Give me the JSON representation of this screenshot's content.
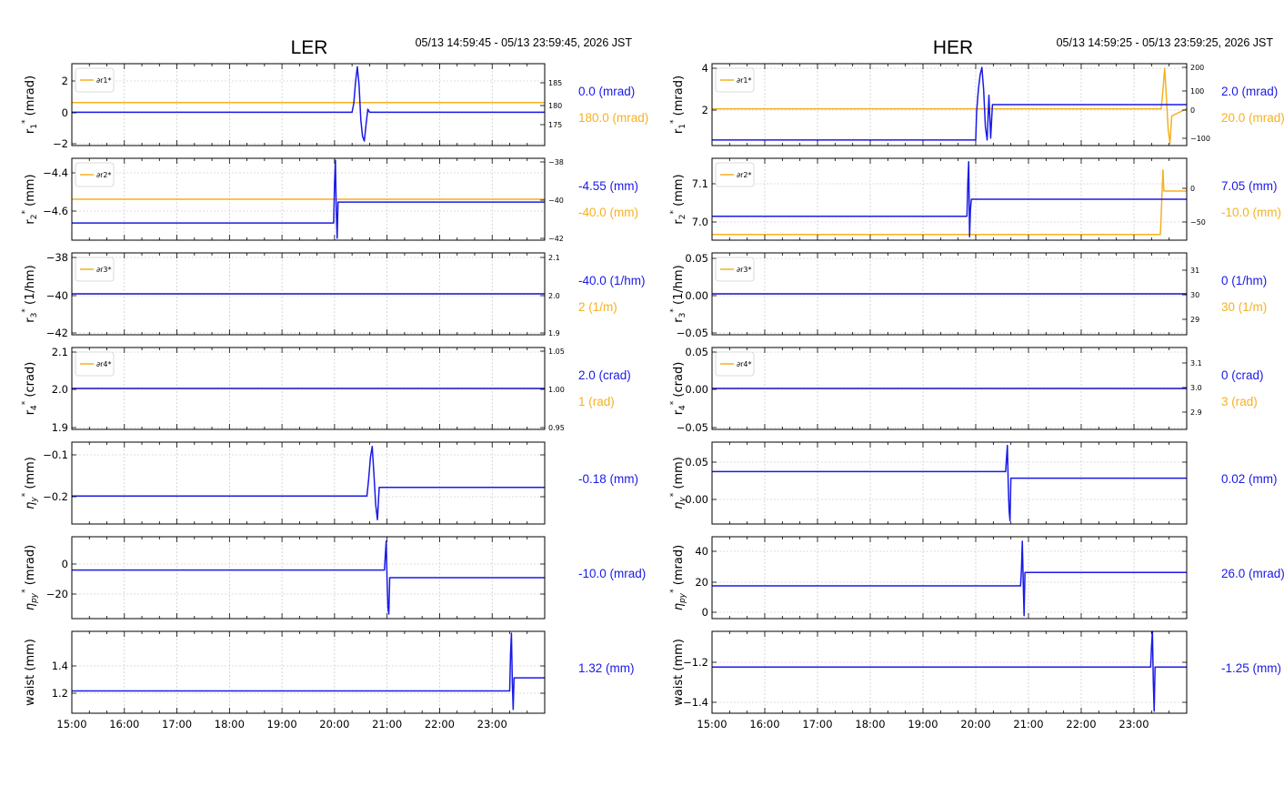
{
  "colors": {
    "blue": "#1a1ae6",
    "orange": "#f5b120",
    "frame": "#000000",
    "grid": "#bdbdbd"
  },
  "panels": [
    {
      "title": "LER",
      "time_range": "05/13 14:59:45 - 05/13 23:59:45, 2026 JST",
      "x_ticks": [
        "15:00",
        "16:00",
        "17:00",
        "18:00",
        "19:00",
        "20:00",
        "21:00",
        "22:00",
        "23:00"
      ],
      "rows": [
        {
          "ylabel": "r1* (mrad)",
          "legend": "∂r1*",
          "left_ticks": [
            "2",
            "0",
            "−2"
          ],
          "right_ticks": [
            "185",
            "180",
            "175"
          ],
          "value_blue": "0.0 (mrad)",
          "value_orange": "180.0 (mrad)"
        },
        {
          "ylabel": "r2* (mm)",
          "legend": "∂r2*",
          "left_ticks": [
            "−4.4",
            "−4.6"
          ],
          "right_ticks": [
            "−38",
            "−40",
            "−42"
          ],
          "value_blue": "-4.55 (mm)",
          "value_orange": "-40.0 (mm)"
        },
        {
          "ylabel": "r3* (1/hm)",
          "legend": "∂r3*",
          "left_ticks": [
            "−38",
            "−40",
            "−42"
          ],
          "right_ticks": [
            "2.1",
            "2.0",
            "1.9"
          ],
          "value_blue": "-40.0 (1/hm)",
          "value_orange": "2 (1/m)"
        },
        {
          "ylabel": "r4* (crad)",
          "legend": "∂r4*",
          "left_ticks": [
            "2.1",
            "2.0",
            "1.9"
          ],
          "right_ticks": [
            "1.05",
            "1.00",
            "0.95"
          ],
          "value_blue": "2.0 (crad)",
          "value_orange": "1 (rad)"
        },
        {
          "ylabel": "ηy* (mm)",
          "left_ticks": [
            "−0.1",
            "−0.2"
          ],
          "value_blue": "-0.18 (mm)"
        },
        {
          "ylabel": "ηpy* (mrad)",
          "left_ticks": [
            "0",
            "−20"
          ],
          "value_blue": "-10.0 (mrad)"
        },
        {
          "ylabel": "waist (mm)",
          "left_ticks": [
            "1.4",
            "1.2"
          ],
          "value_blue": "1.32 (mm)"
        }
      ]
    },
    {
      "title": "HER",
      "time_range": "05/13 14:59:25 - 05/13 23:59:25, 2026 JST",
      "x_ticks": [
        "15:00",
        "16:00",
        "17:00",
        "18:00",
        "19:00",
        "20:00",
        "21:00",
        "22:00",
        "23:00"
      ],
      "rows": [
        {
          "ylabel": "r1* (mrad)",
          "legend": "∂r1*",
          "left_ticks": [
            "4",
            "2"
          ],
          "right_ticks": [
            "200",
            "100",
            "0",
            "−100"
          ],
          "value_blue": "2.0 (mrad)",
          "value_orange": "20.0 (mrad)"
        },
        {
          "ylabel": "r2* (mm)",
          "legend": "∂r2*",
          "left_ticks": [
            "7.1",
            "7.0"
          ],
          "right_ticks": [
            "0",
            "−50"
          ],
          "value_blue": "7.05 (mm)",
          "value_orange": "-10.0 (mm)"
        },
        {
          "ylabel": "r3* (1/hm)",
          "legend": "∂r3*",
          "left_ticks": [
            "0.05",
            "0.00",
            "−0.05"
          ],
          "right_ticks": [
            "31",
            "30",
            "29"
          ],
          "value_blue": "0 (1/hm)",
          "value_orange": "30 (1/m)"
        },
        {
          "ylabel": "r4* (crad)",
          "legend": "∂r4*",
          "left_ticks": [
            "0.05",
            "0.00",
            "−0.05"
          ],
          "right_ticks": [
            "3.1",
            "3.0",
            "2.9"
          ],
          "value_blue": "0 (crad)",
          "value_orange": "3 (rad)"
        },
        {
          "ylabel": "ηy* (mm)",
          "left_ticks": [
            "0.05",
            "0.00"
          ],
          "value_blue": "0.02 (mm)"
        },
        {
          "ylabel": "ηpy* (mrad)",
          "left_ticks": [
            "40",
            "20",
            "0"
          ],
          "value_blue": "26.0 (mrad)"
        },
        {
          "ylabel": "waist (mm)",
          "left_ticks": [
            "−1.2",
            "−1.4"
          ],
          "value_blue": "-1.25 (mm)"
        }
      ]
    }
  ],
  "chart_data": [
    {
      "type": "line",
      "title": "LER",
      "time_range": "05/13 14:59:45 - 05/13 23:59:45, 2026 JST",
      "x_ticks": [
        "15:00",
        "16:00",
        "17:00",
        "18:00",
        "19:00",
        "20:00",
        "21:00",
        "22:00",
        "23:00"
      ],
      "xlim": [
        "15:00",
        "24:00"
      ],
      "grid": true,
      "subplots": [
        {
          "ylabel": "r1* (mrad)",
          "ylim": [
            -2.2,
            3.2
          ],
          "y2lim": [
            172.5,
            188.7
          ],
          "series": [
            {
              "axis": "left",
              "color": "blue",
              "x": [
                "15:00",
                "20:20",
                "20:22",
                "20:24",
                "20:26",
                "20:28",
                "20:30",
                "20:32",
                "20:34",
                "20:36",
                "20:38",
                "20:40",
                "24:00"
              ],
              "y": [
                0.0,
                0.0,
                0.6,
                2.0,
                3.0,
                1.8,
                -0.5,
                -1.6,
                -1.9,
                -0.8,
                0.2,
                0.0,
                0.0
              ]
            },
            {
              "axis": "right",
              "color": "orange",
              "name": "∂r1*",
              "x": [
                "15:00",
                "24:00"
              ],
              "y": [
                181.0,
                181.0
              ]
            }
          ]
        },
        {
          "ylabel": "r2* (mm)",
          "ylim": [
            -4.75,
            -4.32
          ],
          "y2lim": [
            -42.1,
            -37.9
          ],
          "series": [
            {
              "axis": "left",
              "color": "blue",
              "x": [
                "15:00",
                "19:59",
                "20:00",
                "20:01",
                "20:02",
                "20:03",
                "20:04",
                "24:00"
              ],
              "y": [
                -4.66,
                -4.66,
                -4.45,
                -4.33,
                -4.6,
                -4.74,
                -4.55,
                -4.55
              ]
            },
            {
              "axis": "right",
              "color": "orange",
              "name": "∂r2*",
              "x": [
                "15:00",
                "24:00"
              ],
              "y": [
                -40.0,
                -40.0
              ]
            }
          ]
        },
        {
          "ylabel": "r3* (1/hm)",
          "ylim": [
            -42.2,
            -37.8
          ],
          "y2lim": [
            1.89,
            2.11
          ],
          "series": [
            {
              "axis": "left",
              "color": "blue",
              "x": [
                "15:00",
                "24:00"
              ],
              "y": [
                -40.0,
                -40.0
              ]
            },
            {
              "axis": "right",
              "color": "orange",
              "name": "∂r3*",
              "x": [
                "15:00",
                "24:00"
              ],
              "y": [
                2.0,
                2.0
              ]
            }
          ]
        },
        {
          "ylabel": "r4* (crad)",
          "ylim": [
            1.89,
            2.11
          ],
          "y2lim": [
            0.945,
            1.055
          ],
          "series": [
            {
              "axis": "left",
              "color": "blue",
              "x": [
                "15:00",
                "24:00"
              ],
              "y": [
                2.0,
                2.0
              ]
            },
            {
              "axis": "right",
              "color": "orange",
              "name": "∂r4*",
              "x": [
                "15:00",
                "24:00"
              ],
              "y": [
                1.0,
                1.0
              ]
            }
          ]
        },
        {
          "ylabel": "ηy* (mm)",
          "ylim": [
            -0.265,
            -0.075
          ],
          "series": [
            {
              "axis": "left",
              "color": "blue",
              "x": [
                "15:00",
                "20:37",
                "20:39",
                "20:41",
                "20:43",
                "20:45",
                "20:47",
                "20:49",
                "20:51",
                "24:00"
              ],
              "y": [
                -0.2,
                -0.2,
                -0.16,
                -0.11,
                -0.085,
                -0.15,
                -0.22,
                -0.255,
                -0.18,
                -0.18
              ]
            }
          ]
        },
        {
          "ylabel": "ηpy* (mrad)",
          "ylim": [
            -37,
            17
          ],
          "series": [
            {
              "axis": "left",
              "color": "blue",
              "x": [
                "15:00",
                "20:57",
                "20:58",
                "20:59",
                "21:00",
                "21:01",
                "21:02",
                "21:03",
                "24:00"
              ],
              "y": [
                -5,
                -5,
                5,
                14,
                -12,
                -30,
                -34,
                -10,
                -10
              ]
            }
          ]
        },
        {
          "ylabel": "waist (mm)",
          "ylim": [
            1.13,
            1.57
          ],
          "series": [
            {
              "axis": "left",
              "color": "blue",
              "x": [
                "15:00",
                "23:20",
                "23:21",
                "23:22",
                "23:23",
                "23:24",
                "23:25",
                "24:00"
              ],
              "y": [
                1.25,
                1.25,
                1.45,
                1.56,
                1.3,
                1.15,
                1.32,
                1.32
              ]
            }
          ]
        }
      ]
    },
    {
      "type": "line",
      "title": "HER",
      "time_range": "05/13 14:59:25 - 05/13 23:59:25, 2026 JST",
      "x_ticks": [
        "15:00",
        "16:00",
        "17:00",
        "18:00",
        "19:00",
        "20:00",
        "21:00",
        "22:00",
        "23:00"
      ],
      "xlim": [
        "15:00",
        "24:00"
      ],
      "grid": true,
      "subplots": [
        {
          "ylabel": "r1* (mrad)",
          "ylim": [
            -0.2,
            4.2
          ],
          "y2lim": [
            -135,
            210
          ],
          "series": [
            {
              "axis": "left",
              "color": "blue",
              "x": [
                "15:00",
                "20:00",
                "20:01",
                "20:03",
                "20:05",
                "20:07",
                "20:09",
                "20:11",
                "20:13",
                "20:15",
                "20:17",
                "20:19",
                "20:21",
                "20:22",
                "24:00"
              ],
              "y": [
                0.1,
                0.1,
                1.6,
                2.8,
                3.6,
                4.0,
                2.8,
                0.8,
                0.1,
                2.5,
                0.2,
                2.0,
                2.0,
                2.0,
                2.0
              ]
            },
            {
              "axis": "right",
              "color": "orange",
              "name": "∂r1*",
              "x": [
                "15:00",
                "23:30",
                "23:31",
                "23:33",
                "23:35",
                "23:37",
                "23:39",
                "23:41",
                "23:43",
                "24:00"
              ],
              "y": [
                20.0,
                20.0,
                20.0,
                100,
                190,
                60,
                -70,
                -125,
                -10,
                20.0
              ]
            }
          ]
        },
        {
          "ylabel": "r2* (mm)",
          "ylim": [
            6.93,
            7.17
          ],
          "y2lim": [
            -70,
            30
          ],
          "series": [
            {
              "axis": "left",
              "color": "blue",
              "x": [
                "15:00",
                "19:50",
                "19:51",
                "19:52",
                "19:53",
                "19:54",
                "19:55",
                "24:00"
              ],
              "y": [
                7.0,
                7.0,
                7.1,
                7.16,
                6.94,
                7.02,
                7.05,
                7.05
              ]
            },
            {
              "axis": "right",
              "color": "orange",
              "name": "∂r2*",
              "x": [
                "15:00",
                "23:30",
                "23:31",
                "23:32",
                "23:33",
                "23:34",
                "23:35",
                "24:00"
              ],
              "y": [
                -63,
                -63,
                -40,
                -10,
                16,
                -10,
                -10,
                -10
              ]
            }
          ]
        },
        {
          "ylabel": "r3* (1/hm)",
          "ylim": [
            -0.055,
            0.055
          ],
          "y2lim": [
            28.5,
            31.5
          ],
          "series": [
            {
              "axis": "left",
              "color": "blue",
              "x": [
                "15:00",
                "24:00"
              ],
              "y": [
                0.0,
                0.0
              ]
            },
            {
              "axis": "right",
              "color": "orange",
              "name": "∂r3*",
              "x": [
                "15:00",
                "24:00"
              ],
              "y": [
                30,
                30
              ]
            }
          ]
        },
        {
          "ylabel": "r4* (crad)",
          "ylim": [
            -0.055,
            0.055
          ],
          "y2lim": [
            2.82,
            3.18
          ],
          "series": [
            {
              "axis": "left",
              "color": "blue",
              "x": [
                "15:00",
                "24:00"
              ],
              "y": [
                0.0,
                0.0
              ]
            },
            {
              "axis": "right",
              "color": "orange",
              "name": "∂r4*",
              "x": [
                "15:00",
                "24:00"
              ],
              "y": [
                3,
                3
              ]
            }
          ]
        },
        {
          "ylabel": "ηy* (mm)",
          "ylim": [
            -0.05,
            0.075
          ],
          "series": [
            {
              "axis": "left",
              "color": "blue",
              "x": [
                "15:00",
                "20:34",
                "20:35",
                "20:36",
                "20:37",
                "20:38",
                "20:39",
                "20:40",
                "24:00"
              ],
              "y": [
                0.03,
                0.03,
                0.05,
                0.07,
                0.01,
                -0.03,
                -0.045,
                0.02,
                0.02
              ]
            }
          ]
        },
        {
          "ylabel": "ηpy* (mrad)",
          "ylim": [
            -5,
            50
          ],
          "series": [
            {
              "axis": "left",
              "color": "blue",
              "x": [
                "15:00",
                "20:51",
                "20:52",
                "20:53",
                "20:54",
                "20:55",
                "20:56",
                "24:00"
              ],
              "y": [
                17,
                17,
                28,
                47,
                20,
                -3,
                26,
                26
              ]
            }
          ]
        },
        {
          "ylabel": "waist (mm)",
          "ylim": [
            -1.47,
            -1.08
          ],
          "series": [
            {
              "axis": "left",
              "color": "blue",
              "x": [
                "15:00",
                "23:19",
                "23:20",
                "23:21",
                "23:22",
                "23:23",
                "23:24",
                "24:00"
              ],
              "y": [
                -1.25,
                -1.25,
                -1.15,
                -1.08,
                -1.32,
                -1.46,
                -1.25,
                -1.25
              ]
            }
          ]
        }
      ]
    }
  ]
}
